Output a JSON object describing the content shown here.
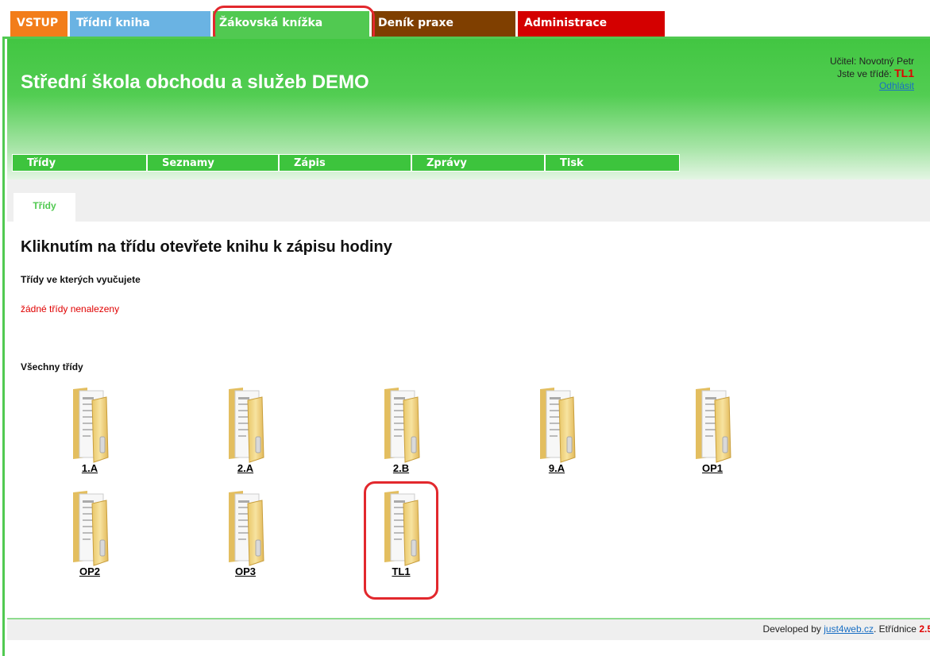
{
  "top_tabs": {
    "vstup": "VSTUP",
    "tridni_kniha": "Třídní kniha",
    "zakovska_knizka": "Žákovská knížka",
    "denik_praxe": "Deník praxe",
    "administrace": "Administrace"
  },
  "header": {
    "school_name": "Střední škola obchodu a služeb DEMO",
    "teacher": "Učitel: Novotný Petr",
    "class_prefix": "Jste ve třídě: ",
    "class_value": "TL1",
    "logout": "Odhlásit"
  },
  "menu": [
    "Třídy",
    "Seznamy",
    "Zápis",
    "Zprávy",
    "Tisk"
  ],
  "subtab": "Třídy",
  "content": {
    "heading": "Kliknutím na třídu otevřete knihu k zápisu hodiny",
    "my_classes_heading": "Třídy ve kterých vyučujete",
    "no_classes": "žádné třídy nenalezeny",
    "all_classes_heading": "Všechny třídy",
    "classes": [
      "1.A",
      "2.A",
      "2.B",
      "9.A",
      "OP1",
      "OP2",
      "OP3",
      "TL1"
    ]
  },
  "footer": {
    "developed_by": "Developed by ",
    "link": "just4web.cz",
    "product": ". Etřídnice ",
    "version": "2.5"
  },
  "colors": {
    "orange": "#f27d1a",
    "blue": "#6ab3e3",
    "green": "#51c951",
    "brown": "#7f3f00",
    "red": "#d40000"
  }
}
